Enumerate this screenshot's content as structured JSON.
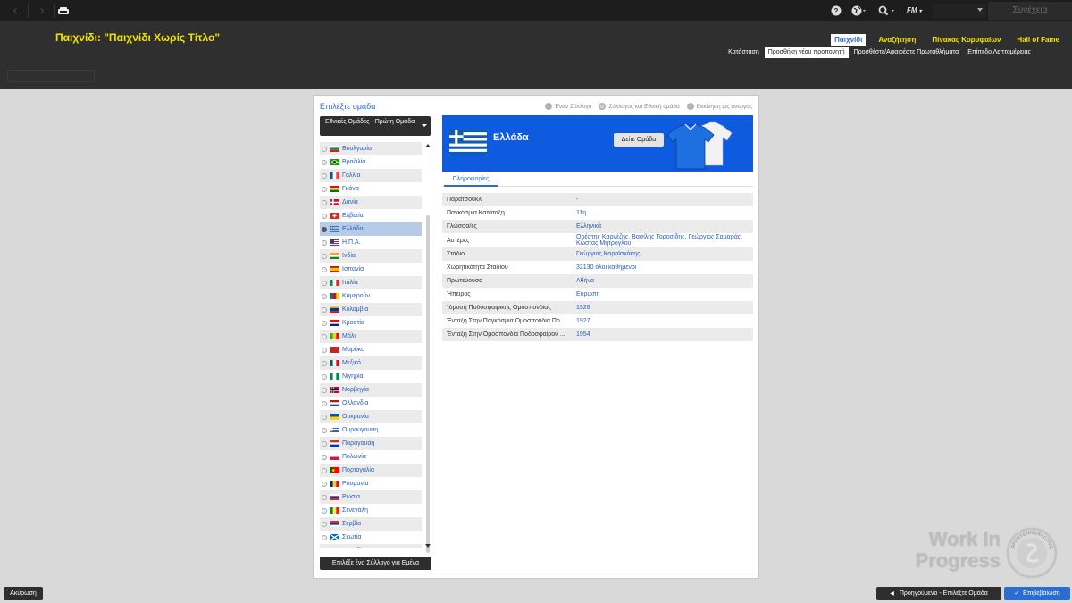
{
  "topbar": {
    "continue_label": "Συνέχεια",
    "fm_label": "FM",
    "icons": [
      "back-arrow-icon",
      "forward-arrow-icon",
      "home-icon",
      "help-icon",
      "globe-icon",
      "search-icon"
    ]
  },
  "header": {
    "title": "Παιχνίδι: \"Παιχνίδι Χωρίς Τίτλο\"",
    "tabs": [
      {
        "label": "Παιχνίδι",
        "active": true
      },
      {
        "label": "Αναζήτηση",
        "active": false
      },
      {
        "label": "Πίνακας Κορυφαίων",
        "active": false
      },
      {
        "label": "Hall of Fame",
        "active": false
      }
    ],
    "subtabs": [
      {
        "label": "Κατάσταση",
        "active": false
      },
      {
        "label": "Προσθήκη νέου προπονητή",
        "active": true
      },
      {
        "label": "Προσθέστε/Αφαιρέστε Πρωταθλήματα",
        "active": false
      },
      {
        "label": "Επίπεδο Λεπτομέρειας",
        "active": false
      }
    ]
  },
  "panel": {
    "title": "Επιλέξτε ομάδα",
    "mode_options": [
      {
        "label": "Έναν Σύλλογο",
        "selected": false
      },
      {
        "label": "Σύλλογος και Εθνική ομάδα",
        "selected": true
      },
      {
        "label": "Εκκίνηση ως άνεργος",
        "selected": false
      }
    ],
    "team_type": "Εθνικές Ομάδες - Πρώτη Ομάδα",
    "countries": [
      {
        "name": "Βουλγαρία",
        "flag": "bulgaria"
      },
      {
        "name": "Βραζιλία",
        "flag": "brazil"
      },
      {
        "name": "Γαλλία",
        "flag": "france"
      },
      {
        "name": "Γκάνα",
        "flag": "ghana"
      },
      {
        "name": "Δανία",
        "flag": "denmark"
      },
      {
        "name": "Ελβετία",
        "flag": "switzerland"
      },
      {
        "name": "Ελλάδα",
        "flag": "greece",
        "active": true
      },
      {
        "name": "Η.Π.Α.",
        "flag": "usa"
      },
      {
        "name": "Ινδία",
        "flag": "india"
      },
      {
        "name": "Ισπανία",
        "flag": "spain"
      },
      {
        "name": "Ιταλία",
        "flag": "italy"
      },
      {
        "name": "Καμερούν",
        "flag": "cameroon"
      },
      {
        "name": "Κολομβία",
        "flag": "colombia"
      },
      {
        "name": "Κροατία",
        "flag": "croatia"
      },
      {
        "name": "Μάλι",
        "flag": "mali"
      },
      {
        "name": "Μαρόκο",
        "flag": "morocco"
      },
      {
        "name": "Μεξικό",
        "flag": "mexico"
      },
      {
        "name": "Νιγηρία",
        "flag": "nigeria"
      },
      {
        "name": "Νορβηγία",
        "flag": "norway"
      },
      {
        "name": "Ολλανδία",
        "flag": "netherlands"
      },
      {
        "name": "Ουκρανία",
        "flag": "ukraine"
      },
      {
        "name": "Ουρουγουάη",
        "flag": "uruguay"
      },
      {
        "name": "Παραγουάη",
        "flag": "paraguay"
      },
      {
        "name": "Πολωνία",
        "flag": "poland"
      },
      {
        "name": "Πορτογαλία",
        "flag": "portugal"
      },
      {
        "name": "Ρουμανία",
        "flag": "romania"
      },
      {
        "name": "Ρωσία",
        "flag": "russia"
      },
      {
        "name": "Σενεγάλη",
        "flag": "senegal"
      },
      {
        "name": "Σερβία",
        "flag": "serbia"
      },
      {
        "name": "Σκωτία",
        "flag": "scotland"
      },
      {
        "name": "Σουηδία",
        "flag": "sweden"
      }
    ],
    "pick_club_label": "Επιλέξε ένα Σύλλογο για Εμένα",
    "selected_team": {
      "name": "Ελλάδα",
      "view_team_label": "Δείτε Ομάδα",
      "info_tab_label": "Πληροφορίες",
      "info": [
        {
          "key": "Παρατσούκλι",
          "value": "-"
        },
        {
          "key": "Παγκόσμια Κατάταξη",
          "value": "11η"
        },
        {
          "key": "Γλώσσα/ες",
          "value": "Ελληνικά"
        },
        {
          "key": "Αστέρες",
          "value": "Ορέστης Καρνέζης, Βασίλης Τοροσίδης, Γεώργιος Σαμαράς, Κώστας Μήτρογλου"
        },
        {
          "key": "Στάδιο",
          "value": "Γεώργιος Καραϊσκάκης"
        },
        {
          "key": "Χωρητικότητα Σταδίου",
          "value": "32130 όλοι καθήμενοι"
        },
        {
          "key": "Πρωτεύουσα",
          "value": "Αθήνα"
        },
        {
          "key": "Ήπειρος",
          "value": "Ευρώπη"
        },
        {
          "key": "Ίδρυση Ποδοσφαιρικής Ομοσπονδίας",
          "value": "1926"
        },
        {
          "key": "Ένταξη Στην Παγκόσμια Ομοσπονδία Πο...",
          "value": "1927"
        },
        {
          "key": "Ένταξη Στην Ομοσπονδία Ποδοσφαίρου ...",
          "value": "1954"
        }
      ]
    }
  },
  "footer": {
    "cancel_label": "Ακύρωση",
    "prev_label": "Προηγούμενο - Επιλέξτε Ομάδα",
    "confirm_label": "Επιβεβαίωση"
  },
  "watermark": {
    "text": "Work In Progress",
    "seal_text": "SPORTS INTERACTIVE"
  },
  "colors": {
    "accent": "#2a6dd0",
    "title_yellow": "#f1e300",
    "banner_blue": "#0f5be0"
  }
}
